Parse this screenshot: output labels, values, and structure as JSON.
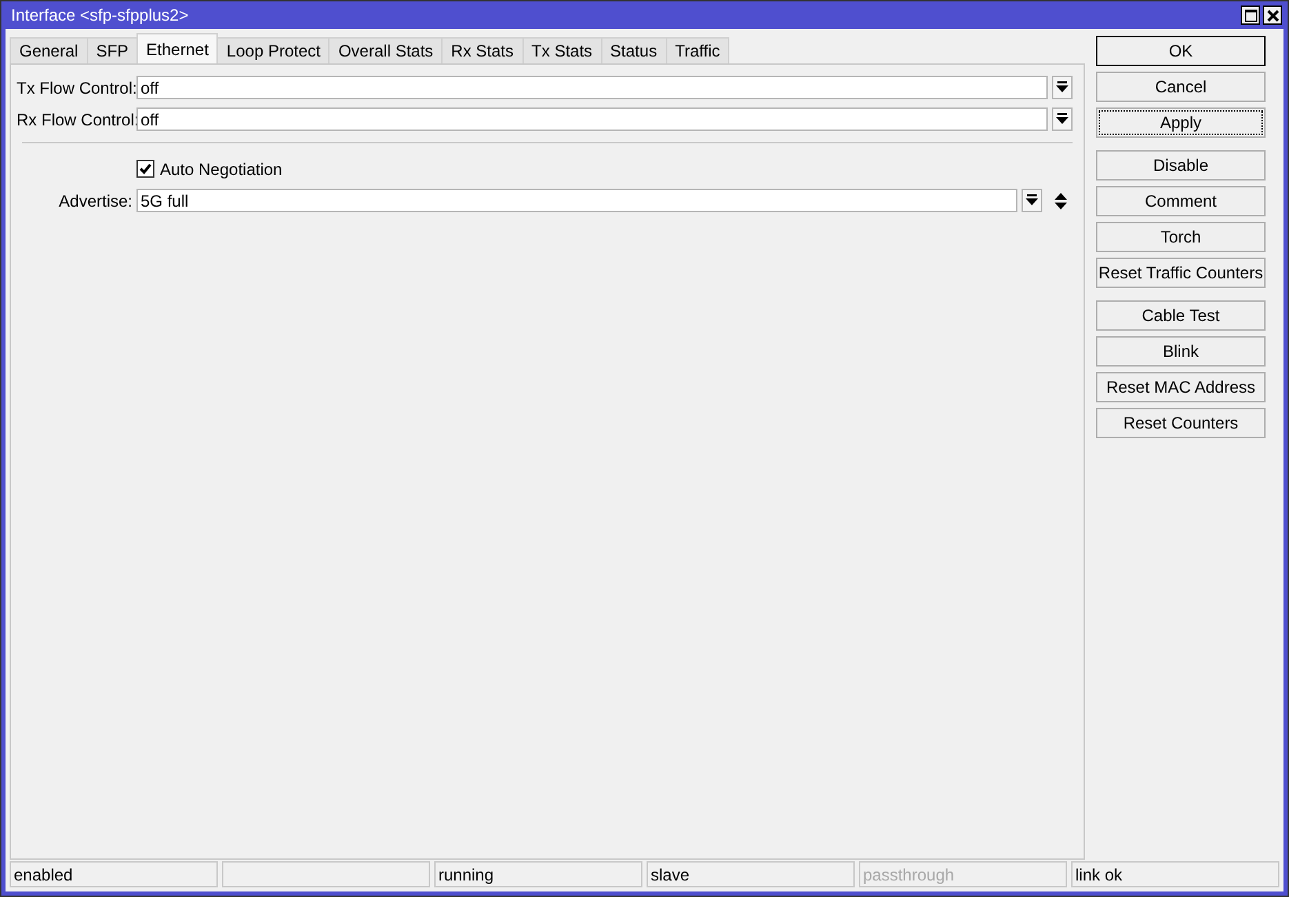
{
  "window": {
    "title": "Interface <sfp-sfpplus2>"
  },
  "tabs": [
    {
      "label": "General",
      "selected": false
    },
    {
      "label": "SFP",
      "selected": false
    },
    {
      "label": "Ethernet",
      "selected": true
    },
    {
      "label": "Loop Protect",
      "selected": false
    },
    {
      "label": "Overall Stats",
      "selected": false
    },
    {
      "label": "Rx Stats",
      "selected": false
    },
    {
      "label": "Tx Stats",
      "selected": false
    },
    {
      "label": "Status",
      "selected": false
    },
    {
      "label": "Traffic",
      "selected": false
    }
  ],
  "fields": [
    {
      "kind": "dropdown",
      "label": "Tx Flow Control:",
      "value": "off"
    },
    {
      "kind": "dropdown",
      "label": "Rx Flow Control:",
      "value": "off"
    },
    {
      "kind": "separator"
    },
    {
      "kind": "checkbox",
      "label": "Auto Negotiation",
      "checked": true
    },
    {
      "kind": "multi",
      "label": "Advertise:",
      "value": "5G full"
    }
  ],
  "button_groups": [
    [
      {
        "label": "OK",
        "default": true,
        "focused": false
      },
      {
        "label": "Cancel",
        "default": false,
        "focused": false
      },
      {
        "label": "Apply",
        "default": false,
        "focused": true
      }
    ],
    [
      {
        "label": "Disable",
        "default": false,
        "focused": false
      },
      {
        "label": "Comment",
        "default": false,
        "focused": false
      },
      {
        "label": "Torch",
        "default": false,
        "focused": false
      },
      {
        "label": "Reset Traffic Counters",
        "default": false,
        "focused": false
      }
    ],
    [
      {
        "label": "Cable Test",
        "default": false,
        "focused": false
      },
      {
        "label": "Blink",
        "default": false,
        "focused": false
      },
      {
        "label": "Reset MAC Address",
        "default": false,
        "focused": false
      },
      {
        "label": "Reset Counters",
        "default": false,
        "focused": false
      }
    ]
  ],
  "status_bar": [
    {
      "kind": "text",
      "text": "enabled",
      "disabled": false
    },
    {
      "kind": "blank"
    },
    {
      "kind": "text",
      "text": "running",
      "disabled": false
    },
    {
      "kind": "text",
      "text": "slave",
      "disabled": false
    },
    {
      "kind": "text",
      "text": "passthrough",
      "disabled": true
    },
    {
      "kind": "text",
      "text": "link ok",
      "disabled": false
    }
  ]
}
